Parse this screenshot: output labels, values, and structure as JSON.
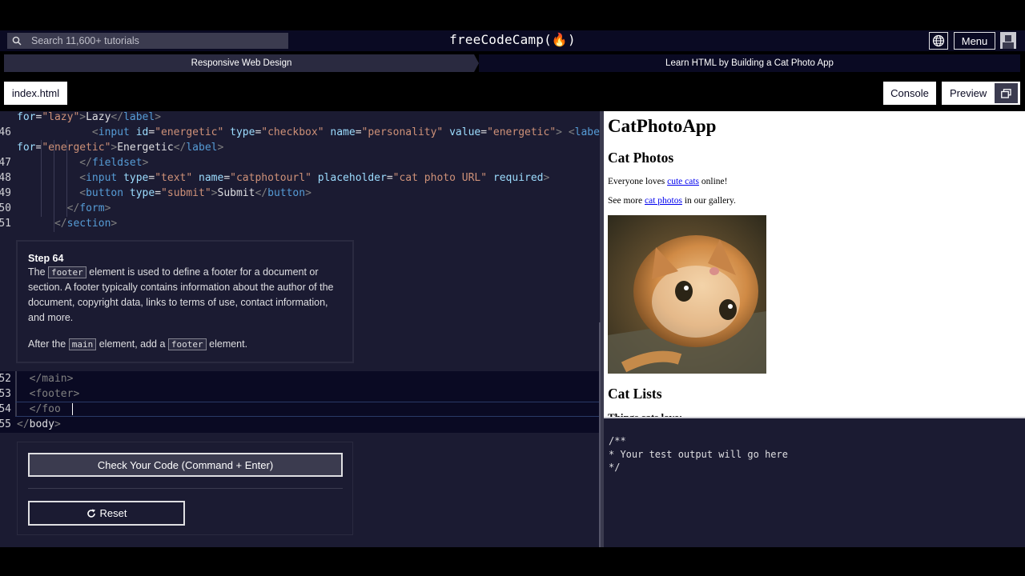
{
  "navbar": {
    "search_placeholder": "Search 11,600+ tutorials",
    "brand": "freeCodeCamp(🔥)",
    "menu_label": "Menu",
    "icons": [
      "search-icon",
      "globe-icon",
      "avatar-icon"
    ]
  },
  "breadcrumb": {
    "course": "Responsive Web Design",
    "project": "Learn HTML by Building a Cat Photo App"
  },
  "editor": {
    "file_tab": "index.html",
    "lines_top": [
      {
        "num": "",
        "html": "<span class=\"a\">for</span>=<span class=\"s\">\"lazy\"</span><span class=\"g\">&gt;</span>Lazy<span class=\"g\">&lt;/</span><span class=\"t\">label</span><span class=\"g\">&gt;</span>"
      },
      {
        "num": "46",
        "html": "            <span class=\"g\">&lt;</span><span class=\"t\">input</span> <span class=\"a\">id</span>=<span class=\"s\">\"energetic\"</span> <span class=\"a\">type</span>=<span class=\"s\">\"checkbox\"</span> <span class=\"a\">name</span>=<span class=\"s\">\"personality\"</span> <span class=\"a\">value</span>=<span class=\"s\">\"energetic\"</span><span class=\"g\">&gt;</span> <span class=\"g\">&lt;</span><span class=\"t\">label</span>"
      },
      {
        "num": "",
        "html": "<span class=\"a\">for</span>=<span class=\"s\">\"energetic\"</span><span class=\"g\">&gt;</span>Energetic<span class=\"g\">&lt;/</span><span class=\"t\">label</span><span class=\"g\">&gt;</span>"
      },
      {
        "num": "47",
        "html": "          <span class=\"g\">&lt;/</span><span class=\"t\">fieldset</span><span class=\"g\">&gt;</span>"
      },
      {
        "num": "48",
        "html": "          <span class=\"g\">&lt;</span><span class=\"t\">input</span> <span class=\"a\">type</span>=<span class=\"s\">\"text\"</span> <span class=\"a\">name</span>=<span class=\"s\">\"catphotourl\"</span> <span class=\"a\">placeholder</span>=<span class=\"s\">\"cat photo URL\"</span> <span class=\"a\">required</span><span class=\"g\">&gt;</span>"
      },
      {
        "num": "49",
        "html": "          <span class=\"g\">&lt;</span><span class=\"t\">button</span> <span class=\"a\">type</span>=<span class=\"s\">\"submit\"</span><span class=\"g\">&gt;</span>Submit<span class=\"g\">&lt;/</span><span class=\"t\">button</span><span class=\"g\">&gt;</span>"
      },
      {
        "num": "50",
        "html": "        <span class=\"g\">&lt;/</span><span class=\"t\">form</span><span class=\"g\">&gt;</span>"
      },
      {
        "num": "51",
        "html": "      <span class=\"g\">&lt;/</span><span class=\"t\">section</span><span class=\"g\">&gt;</span>"
      }
    ],
    "lines_bottom": [
      {
        "num": "52",
        "html": "  <span class=\"g\">&lt;/main&gt;</span>"
      },
      {
        "num": "53",
        "html": "  <span class=\"g\">&lt;footer&gt;</span>"
      },
      {
        "num": "54",
        "html": "  <span class=\"g\">&lt;/foo</span>"
      },
      {
        "num": "55",
        "html": "<span class=\"g\">&lt;/</span>body<span class=\"g\">&gt;</span>"
      }
    ]
  },
  "instructions": {
    "step": "Step 64",
    "p1_before": "The",
    "p1_code": "footer",
    "p1_after": "element is used to define a footer for a document or section. A footer typically contains information about the author of the document, copyright data, links to terms of use, contact information, and more.",
    "p2_before": "After the",
    "p2_code1": "main",
    "p2_mid": "element, add a",
    "p2_code2": "footer",
    "p2_after": "element."
  },
  "actions": {
    "check_label": "Check Your Code (Command + Enter)",
    "reset_label": "Reset"
  },
  "toolbar": {
    "console_label": "Console",
    "preview_label": "Preview"
  },
  "preview": {
    "title": "CatPhotoApp",
    "cat_photos_heading": "Cat Photos",
    "p1_before": "Everyone loves ",
    "p1_link": "cute cats",
    "p1_after": " online!",
    "p2_before": "See more ",
    "p2_link": "cat photos",
    "p2_after": " in our gallery.",
    "cat_lists_heading": "Cat Lists",
    "things_heading": "Things cats love:"
  },
  "test_output": "/**\n* Your test output will go here\n*/",
  "colors": {
    "navbar_bg": "#0a0a23",
    "editor_bg": "#1b1b32",
    "tag": "#569cd6",
    "attribute": "#9cdcfe",
    "string": "#ce9178"
  }
}
